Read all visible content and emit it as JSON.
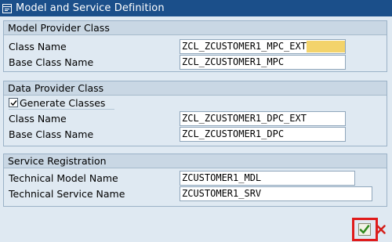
{
  "window": {
    "title": "Model and Service Definition"
  },
  "model_provider": {
    "header": "Model Provider Class",
    "class_name_label": "Class Name",
    "class_name_value": "ZCL_ZCUSTOMER1_MPC_EXT",
    "base_class_label": "Base Class Name",
    "base_class_value": "ZCL_ZCUSTOMER1_MPC"
  },
  "data_provider": {
    "header": "Data Provider Class",
    "generate_label": "Generate Classes",
    "generate_checked": true,
    "class_name_label": "Class Name",
    "class_name_value": "ZCL_ZCUSTOMER1_DPC_EXT",
    "base_class_label": "Base Class Name",
    "base_class_value": "ZCL_ZCUSTOMER1_DPC"
  },
  "service_registration": {
    "header": "Service Registration",
    "model_label": "Technical Model Name",
    "model_value": "ZCUSTOMER1_MDL",
    "service_label": "Technical Service Name",
    "service_value": "ZCUSTOMER1_SRV"
  },
  "icons": {
    "window": "window-icon",
    "confirm": "checkmark-icon",
    "cancel": "cancel-x-icon"
  },
  "colors": {
    "title_bar": "#1b4f8a",
    "confirm_green": "#2f8a1e",
    "cancel_red": "#d4201c",
    "highlight": "#e01b1b"
  }
}
